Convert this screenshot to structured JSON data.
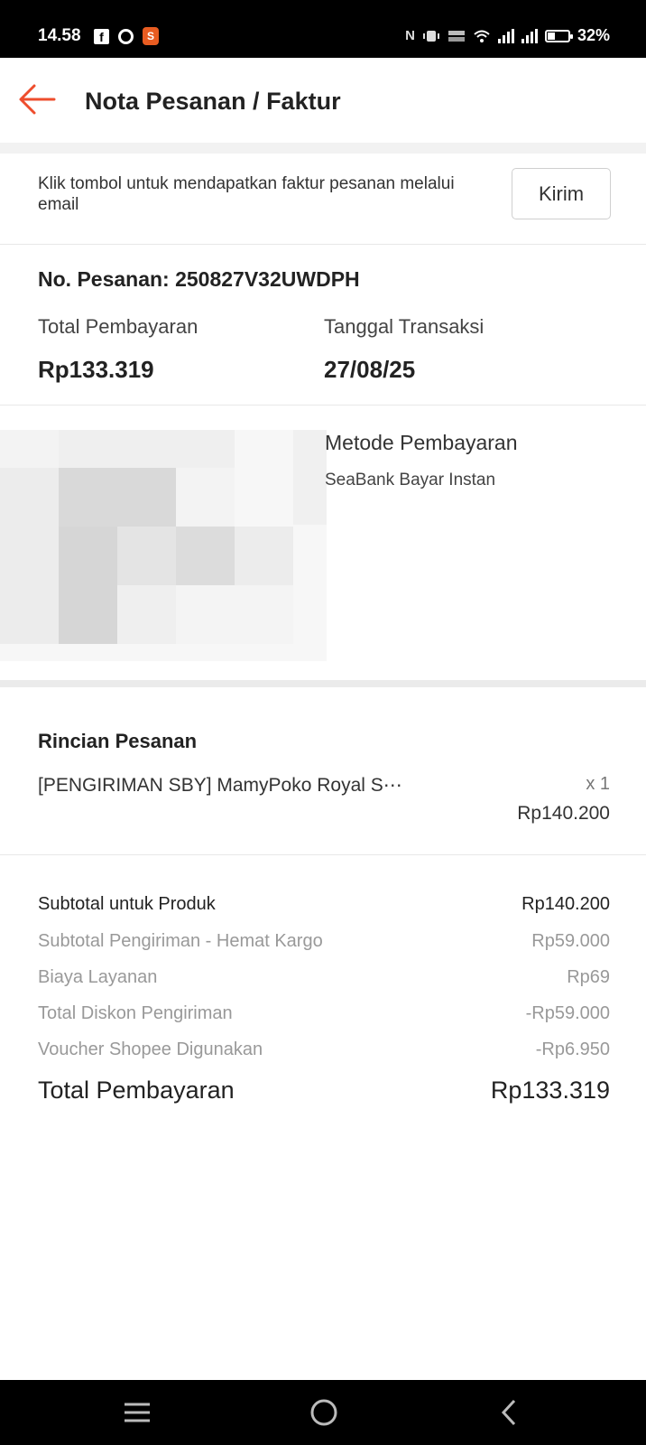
{
  "status_bar": {
    "time": "14.58",
    "battery": "32%",
    "battery_level": 0.32,
    "icons": [
      "facebook-icon",
      "circle-app-icon",
      "shopee-icon",
      "nfc-icon",
      "vibrate-icon",
      "volte-icon",
      "wifi-icon",
      "signal-icon",
      "signal-icon",
      "battery-icon"
    ]
  },
  "header": {
    "title": "Nota Pesanan / Faktur"
  },
  "email_banner": {
    "text": "Klik tombol untuk mendapatkan faktur pesanan melalui email",
    "button_label": "Kirim"
  },
  "order": {
    "number": "No. Pesanan: 250827V32UWDPH",
    "total_label": "Total Pembayaran",
    "total_value": "Rp133.319",
    "date_label": "Tanggal Transaksi",
    "date_value": "27/08/25",
    "payment_method_label": "Metode Pembayaran",
    "payment_method_value": "SeaBank Bayar Instan"
  },
  "details": {
    "title": "Rincian Pesanan",
    "items": [
      {
        "name": "[PENGIRIMAN SBY] MamyPoko Royal S⋯",
        "qty": "x 1",
        "price": "Rp140.200"
      }
    ]
  },
  "summary": {
    "rows": [
      {
        "label": "Subtotal untuk Produk",
        "value": "Rp140.200"
      },
      {
        "label": "Subtotal Pengiriman - Hemat Kargo",
        "value": "Rp59.000"
      },
      {
        "label": "Biaya Layanan",
        "value": "Rp69"
      },
      {
        "label": "Total Diskon Pengiriman",
        "value": "-Rp59.000"
      },
      {
        "label": "Voucher Shopee Digunakan",
        "value": "-Rp6.950"
      }
    ],
    "total_label": "Total Pembayaran",
    "total_value": "Rp133.319"
  },
  "colors": {
    "accent": "#ee4d2d",
    "muted_text": "#999999"
  }
}
